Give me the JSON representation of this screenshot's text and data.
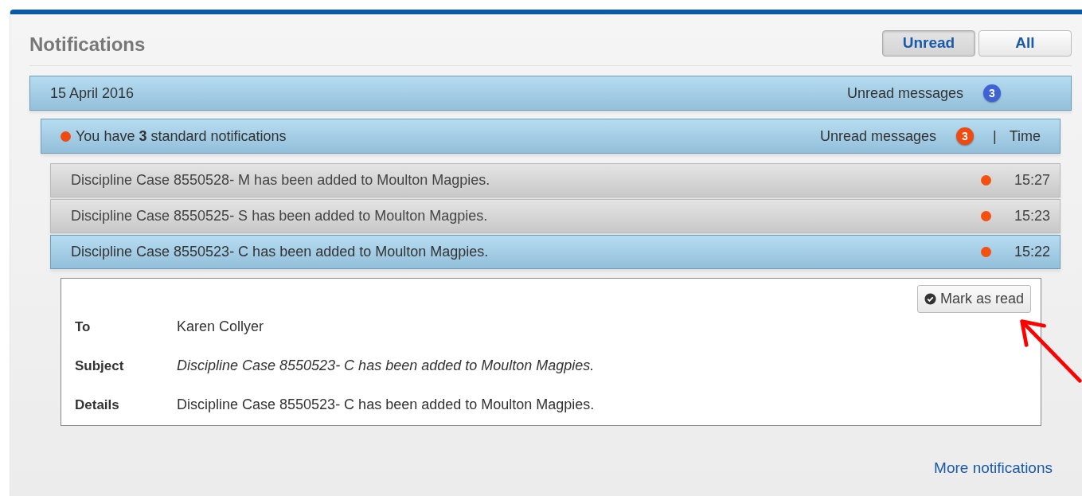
{
  "title": "Notifications",
  "filters": [
    {
      "label": "Unread",
      "selected": true
    },
    {
      "label": "All",
      "selected": false
    }
  ],
  "date_group": {
    "date": "15 April 2016",
    "unread_label": "Unread messages",
    "unread_count": "3"
  },
  "category": {
    "text": "You have **3** standard notifications",
    "unread_label": "Unread messages",
    "unread_count": "3",
    "separator": "|",
    "time_label": "Time"
  },
  "messages": [
    {
      "text": "Discipline Case 8550528- M has been added to Moulton Magpies.",
      "time": "15:27",
      "unread": true,
      "selected": false
    },
    {
      "text": "Discipline Case 8550525- S has been added to Moulton Magpies.",
      "time": "15:23",
      "unread": true,
      "selected": false
    },
    {
      "text": "Discipline Case 8550523- C has been added to Moulton Magpies.",
      "time": "15:22",
      "unread": true,
      "selected": true
    }
  ],
  "detail": {
    "mark_button": "Mark as read",
    "fields": [
      {
        "label": "To",
        "value": "Karen Collyer",
        "kind": "plain"
      },
      {
        "label": "Subject",
        "value": "Discipline Case 8550523- C has been added to Moulton Magpies.",
        "kind": "italic"
      },
      {
        "label": "Details",
        "value": "Discipline Case 8550523- C has been added to Moulton Magpies.",
        "kind": "plain"
      }
    ]
  },
  "more_link": "More notifications"
}
